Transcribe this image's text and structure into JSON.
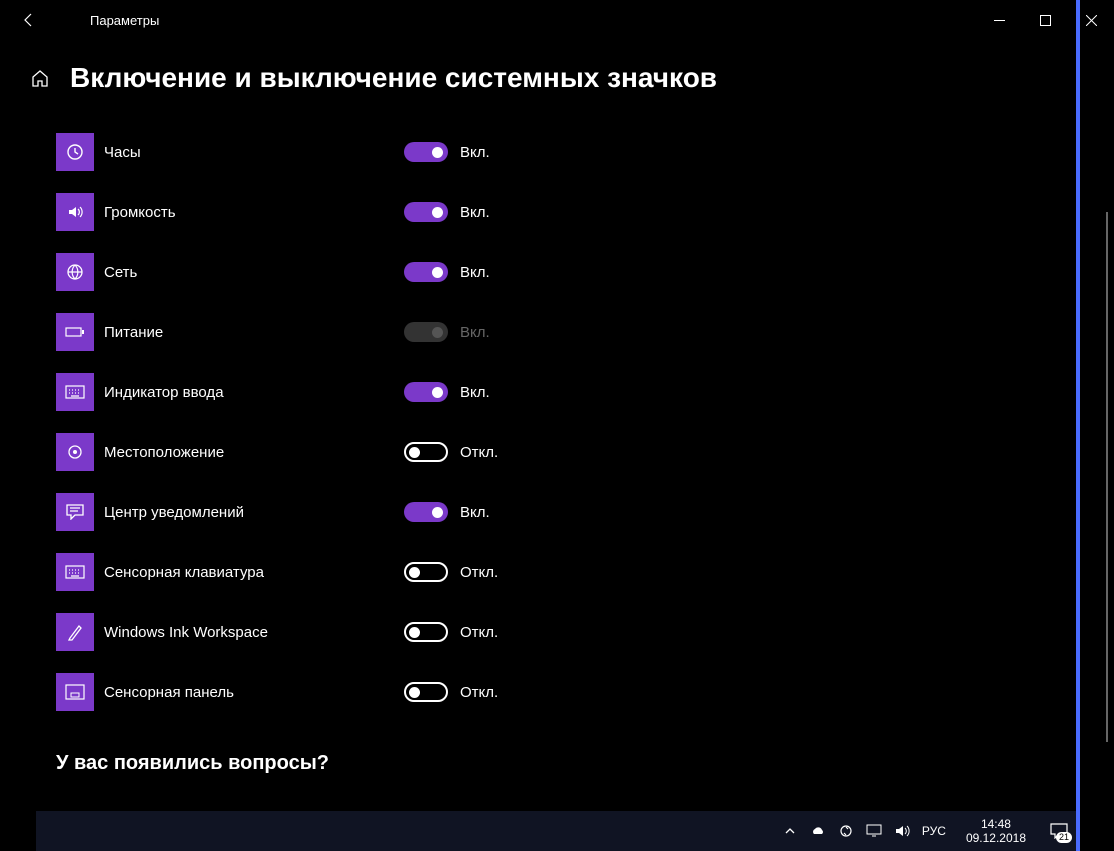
{
  "window": {
    "title": "Параметры"
  },
  "page": {
    "heading": "Включение и выключение системных значков",
    "question": "У вас появились вопросы?"
  },
  "state_labels": {
    "on": "Вкл.",
    "off": "Откл."
  },
  "settings": [
    {
      "id": "clock",
      "label": "Часы",
      "on": true,
      "enabled": true,
      "icon": "clock"
    },
    {
      "id": "volume",
      "label": "Громкость",
      "on": true,
      "enabled": true,
      "icon": "volume"
    },
    {
      "id": "network",
      "label": "Сеть",
      "on": true,
      "enabled": true,
      "icon": "globe"
    },
    {
      "id": "power",
      "label": "Питание",
      "on": true,
      "enabled": false,
      "icon": "battery"
    },
    {
      "id": "input-indicator",
      "label": "Индикатор ввода",
      "on": true,
      "enabled": true,
      "icon": "keyboard"
    },
    {
      "id": "location",
      "label": "Местоположение",
      "on": false,
      "enabled": true,
      "icon": "target"
    },
    {
      "id": "action-center",
      "label": "Центр уведомлений",
      "on": true,
      "enabled": true,
      "icon": "message"
    },
    {
      "id": "touch-keyboard",
      "label": "Сенсорная клавиатура",
      "on": false,
      "enabled": true,
      "icon": "keyboard"
    },
    {
      "id": "windows-ink",
      "label": "Windows Ink Workspace",
      "on": false,
      "enabled": true,
      "icon": "pen"
    },
    {
      "id": "touchpad",
      "label": "Сенсорная панель",
      "on": false,
      "enabled": true,
      "icon": "touchpad"
    }
  ],
  "taskbar": {
    "language": "РУС",
    "time": "14:48",
    "date": "09.12.2018",
    "notification_count": "21"
  }
}
